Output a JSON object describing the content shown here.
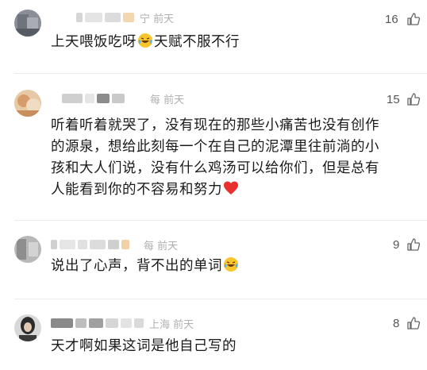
{
  "comments": [
    {
      "meta": "宁 前天",
      "likes": "16",
      "text_a": "上天喂饭吃呀",
      "text_b": "天赋不服不行",
      "emoji_a": "laughing-tears-emoji"
    },
    {
      "meta": "每 前天",
      "likes": "15",
      "lines": [
        "听着听着就哭了，没有现在的那些小痛苦也没有创作",
        "的源泉，想给此刻每一个在自己的泥潭里往前淌的小",
        "孩和大人们说，没有什么鸡汤可以给你们，但是总有",
        "人能看到你的不容易和努力"
      ],
      "emoji_end": "red-heart-emoji"
    },
    {
      "meta": "每 前天",
      "likes": "9",
      "text_a": "说出了心声，背不出的单词",
      "emoji_end": "laughing-tears-emoji"
    },
    {
      "meta": "上海 前天",
      "likes": "8",
      "text_a": "天才啊如果这词是他自己写的"
    }
  ],
  "icons": {
    "like": "thumbs-up-icon"
  },
  "colors": {
    "text": "#1a1a1a",
    "meta": "#b0b0b0",
    "divider": "#ececec"
  }
}
